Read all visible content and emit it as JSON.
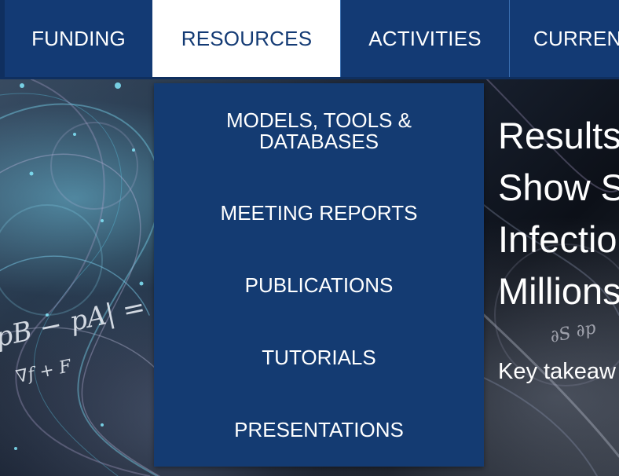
{
  "nav": {
    "items": [
      {
        "label": "FUNDING"
      },
      {
        "label": "RESOURCES"
      },
      {
        "label": "ACTIVITIES"
      },
      {
        "label": "CURREN"
      }
    ]
  },
  "dropdown": {
    "items": [
      {
        "line1": "MODELS, TOOLS &",
        "line2": "DATABASES"
      },
      {
        "line1": "MEETING REPORTS"
      },
      {
        "line1": "PUBLICATIONS"
      },
      {
        "line1": "TUTORIALS"
      },
      {
        "line1": "PRESENTATIONS"
      }
    ]
  },
  "hero": {
    "headline_lines": [
      "Results",
      "Show S",
      "Infectio",
      "Millions"
    ],
    "takeaway": "Key takeaw",
    "formula_1": "pB − pA| = |p",
    "formula_2": "∇f + F",
    "formula_3": "∂S ∂p"
  },
  "colors": {
    "nav_bg": "#133a74",
    "dropdown_bg": "#143b72",
    "active_tab_bg": "#ffffff"
  }
}
